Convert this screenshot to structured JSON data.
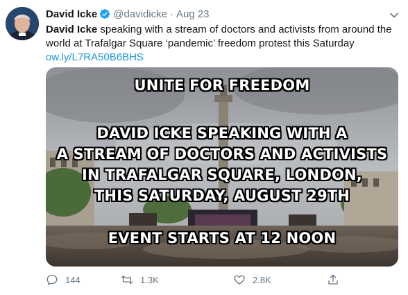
{
  "tweet": {
    "display_name": "David Icke",
    "handle": "@davidicke",
    "separator": "·",
    "time": "Aug 23",
    "text_bold": "David Icke",
    "text_line1": " speaking with a stream of doctors and activists from around the",
    "text_line2": "world at Trafalgar Square ‘pandemic’ freedom protest this Saturday",
    "link": "ow.ly/L7RA50B6BHS"
  },
  "image": {
    "headline": "UNITE FOR FREEDOM",
    "body_lines": [
      "DAVID ICKE SPEAKING WITH A",
      "A STREAM OF DOCTORS AND ACTIVISTS",
      "IN TRAFALGAR SQUARE, LONDON,",
      "THIS SATURDAY, AUGUST 29TH"
    ],
    "footer": "EVENT STARTS AT 12 NOON"
  },
  "actions": {
    "replies": "144",
    "retweets": "1.3K",
    "likes": "2.8K"
  },
  "icons": {
    "verified": "verified-badge-icon",
    "more": "chevron-down-icon",
    "reply": "reply-icon",
    "retweet": "retweet-icon",
    "like": "heart-icon",
    "share": "share-icon"
  },
  "colors": {
    "link": "#1b95e0",
    "secondary": "#657786",
    "verified": "#1da1f2"
  }
}
